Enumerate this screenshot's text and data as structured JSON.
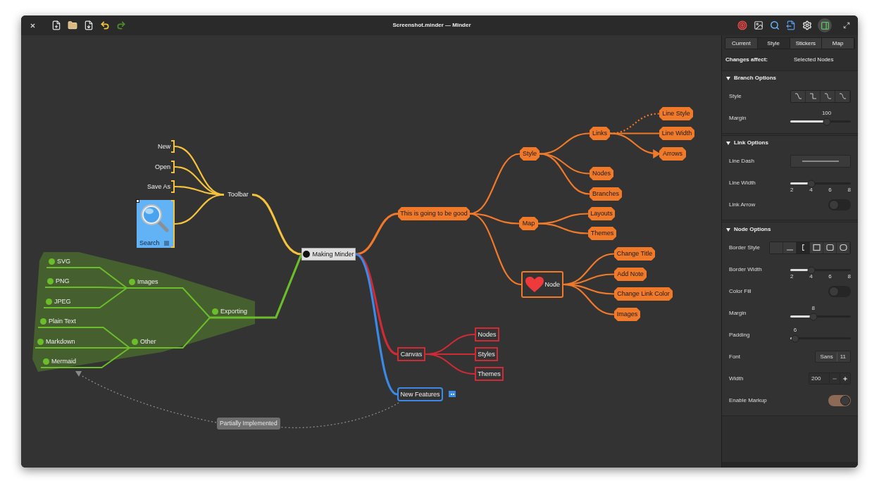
{
  "window": {
    "title": "Screenshot.minder — Minder",
    "sidebar_toggle": {
      "on": true
    }
  },
  "map": {
    "label": "Making Minder",
    "kind": "root",
    "children": [
      {
        "label": "Toolbar",
        "kind": "plain",
        "color": "#f4c23c",
        "children": [
          {
            "label": "New",
            "kind": "bracket"
          },
          {
            "label": "Open",
            "kind": "bracket"
          },
          {
            "label": "Save As",
            "kind": "bracket"
          },
          {
            "label": "Search",
            "kind": "picture"
          }
        ]
      },
      {
        "label": "This is going to be good",
        "kind": "hexagon",
        "color": "#f07a2a",
        "children": [
          {
            "label": "Style",
            "kind": "hexagon",
            "children": [
              {
                "label": "Links",
                "kind": "hexagon",
                "children": [
                  {
                    "label": "Line Style",
                    "kind": "hexagon",
                    "dotted": true,
                    "arrow": false
                  },
                  {
                    "label": "Line Width",
                    "kind": "hexagon",
                    "dotted": false,
                    "arrow": false
                  },
                  {
                    "label": "Arrows",
                    "kind": "hexagon",
                    "dotted": false,
                    "arrow": true
                  }
                ]
              },
              {
                "label": "Nodes",
                "kind": "hexagon"
              },
              {
                "label": "Branches",
                "kind": "hexagon"
              }
            ]
          },
          {
            "label": "Map",
            "kind": "hexagon",
            "children": [
              {
                "label": "Layouts",
                "kind": "hexagon"
              },
              {
                "label": "Themes",
                "kind": "hexagon"
              }
            ]
          },
          {
            "label": "Node",
            "kind": "sticker",
            "children": [
              {
                "label": "Change Title",
                "kind": "hexagon"
              },
              {
                "label": "Add Note",
                "kind": "hexagon"
              },
              {
                "label": "Change Link Color",
                "kind": "hexagon"
              },
              {
                "label": "Images",
                "kind": "hexagon"
              }
            ]
          }
        ]
      },
      {
        "label": "Canvas",
        "kind": "box",
        "color": "#d02a34",
        "children": [
          {
            "label": "Nodes",
            "kind": "box"
          },
          {
            "label": "Styles",
            "kind": "box"
          },
          {
            "label": "Themes",
            "kind": "box"
          }
        ]
      },
      {
        "label": "New Features",
        "kind": "rounded",
        "color": "#3a8ae6"
      },
      {
        "label": "Exporting",
        "kind": "dot",
        "color": "#6bbd2a",
        "children": [
          {
            "label": "Images",
            "kind": "dot",
            "children": [
              {
                "label": "SVG",
                "kind": "dot"
              },
              {
                "label": "PNG",
                "kind": "dot"
              },
              {
                "label": "JPEG",
                "kind": "dot"
              }
            ]
          },
          {
            "label": "Other",
            "kind": "dot",
            "children": [
              {
                "label": "Plain Text",
                "kind": "dot"
              },
              {
                "label": "Markdown",
                "kind": "dot"
              },
              {
                "label": "Mermaid",
                "kind": "dot"
              }
            ]
          }
        ]
      }
    ]
  },
  "connection": {
    "label": "Partially Implemented"
  },
  "panel": {
    "tabs": [
      {
        "label": "Current",
        "selected": false
      },
      {
        "label": "Style",
        "selected": true
      },
      {
        "label": "Stickers",
        "selected": false
      },
      {
        "label": "Map",
        "selected": false
      }
    ],
    "scope_label": "Changes affect:",
    "scope_value": "Selected Nodes",
    "sections": [
      {
        "title": "Branch Options",
        "expanded": true,
        "rows": [
          {
            "kind": "segmented",
            "label": "Style",
            "options": [
              {
                "selected": false
              },
              {
                "selected": false
              },
              {
                "selected": false
              },
              {
                "selected": false
              }
            ]
          },
          {
            "kind": "slider",
            "label": "Margin",
            "reading": "100",
            "level": 0.6
          }
        ]
      },
      {
        "title": "Link Options",
        "expanded": true,
        "rows": [
          {
            "kind": "dash",
            "label": "Line Dash"
          },
          {
            "kind": "slider",
            "label": "Line Width",
            "level": 0.35,
            "ticks": [
              "2",
              "4",
              "6",
              "8"
            ]
          },
          {
            "kind": "switch",
            "label": "Link Arrow",
            "on": false
          }
        ]
      },
      {
        "title": "Node Options",
        "expanded": true,
        "rows": [
          {
            "kind": "segmented",
            "label": "Border Style",
            "options": [
              {
                "selected": false
              },
              {
                "selected": false
              },
              {
                "selected": true
              },
              {
                "selected": false
              },
              {
                "selected": false
              },
              {
                "selected": false
              }
            ]
          },
          {
            "kind": "slider",
            "label": "Border Width",
            "level": 0.35,
            "ticks": [
              "2",
              "4",
              "6",
              "8"
            ]
          },
          {
            "kind": "switch",
            "label": "Color Fill",
            "on": false
          },
          {
            "kind": "slider",
            "label": "Margin",
            "reading": "8",
            "level": 0.38
          },
          {
            "kind": "slider",
            "label": "Padding",
            "reading": "6",
            "level": 0.08
          },
          {
            "kind": "font",
            "label": "Font",
            "value": "Sans",
            "size": "11"
          },
          {
            "kind": "spin",
            "label": "Width",
            "value": "200"
          },
          {
            "kind": "switch",
            "label": "Enable Markup",
            "on": true
          }
        ]
      }
    ]
  }
}
